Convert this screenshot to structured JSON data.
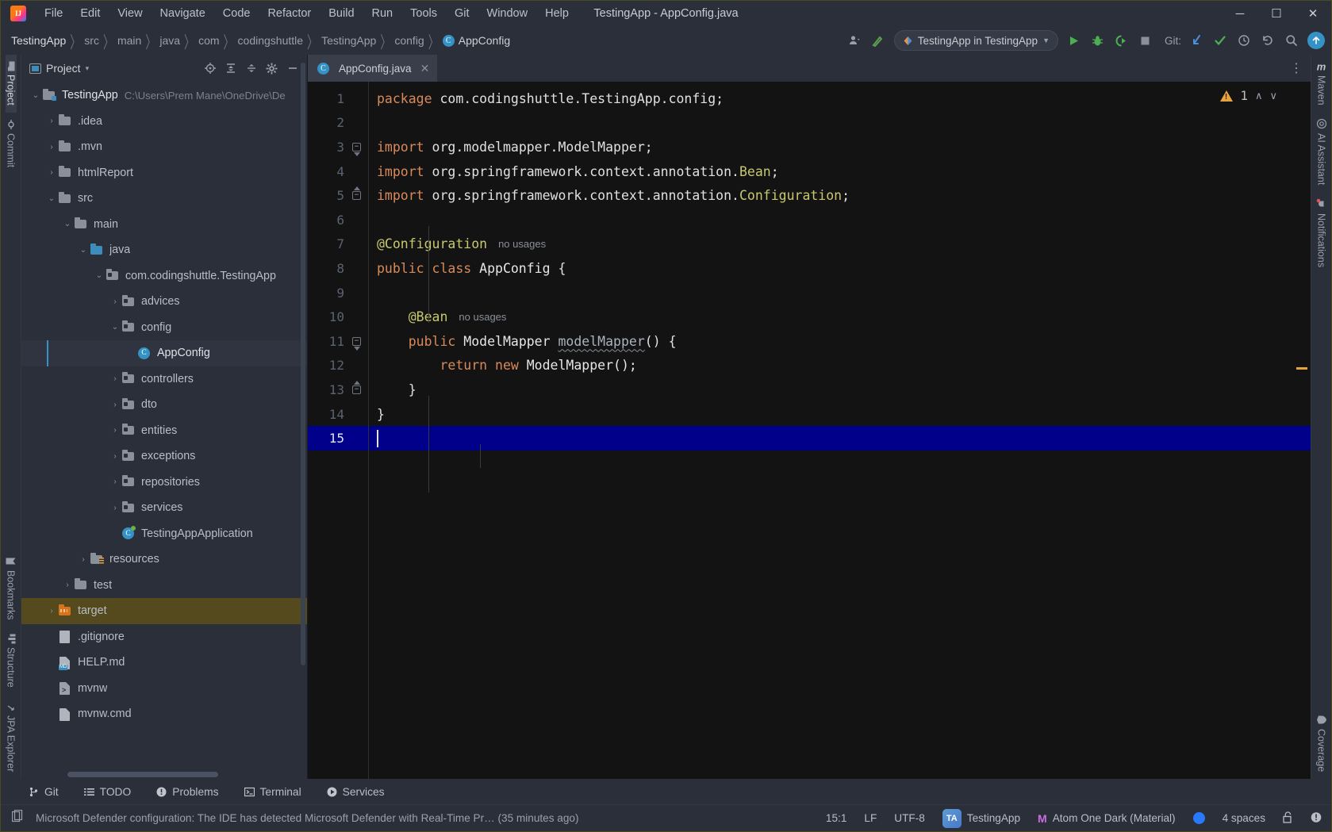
{
  "window": {
    "title": "TestingApp - AppConfig.java",
    "minimize": "─",
    "maximize": "☐",
    "close": "✕"
  },
  "menu": {
    "items": [
      "File",
      "Edit",
      "View",
      "Navigate",
      "Code",
      "Refactor",
      "Build",
      "Run",
      "Tools",
      "Git",
      "Window",
      "Help"
    ]
  },
  "navbar": {
    "breadcrumb": [
      "TestingApp",
      "src",
      "main",
      "java",
      "com",
      "codingshuttle",
      "TestingApp",
      "config",
      "AppConfig"
    ],
    "separator": "〉",
    "class_badge": "C",
    "run_config": "TestingApp in TestingApp",
    "run_config_caret": "▼",
    "git_label": "Git:",
    "icons": {
      "profile": "👤",
      "profile_caret": "▾",
      "build": "↖",
      "run": "▶",
      "debug": "🐞",
      "coverage": "◑",
      "stop": "■",
      "git_update": "↙",
      "git_commit": "✓",
      "history": "◴",
      "rollback": "↺",
      "search": "🔍",
      "update": "↑"
    }
  },
  "left_strip": {
    "top": [
      {
        "label": "Project",
        "icon": "project-icon",
        "active": true
      },
      {
        "label": "Commit",
        "icon": "commit-icon",
        "active": false
      }
    ],
    "bottom": [
      {
        "label": "Bookmarks",
        "icon": "bookmark-icon"
      },
      {
        "label": "Structure",
        "icon": "structure-icon"
      },
      {
        "label": "JPA Explorer",
        "icon": "jpa-icon"
      }
    ]
  },
  "right_strip": {
    "top": [
      {
        "label": "Maven",
        "icon": "maven-icon"
      },
      {
        "label": "AI Assistant",
        "icon": "ai-icon"
      },
      {
        "label": "Notifications",
        "icon": "notifications-icon"
      }
    ],
    "bottom": [
      {
        "label": "Coverage",
        "icon": "coverage-icon"
      }
    ]
  },
  "project_panel": {
    "title": "Project",
    "caret": "▾",
    "actions": [
      "locate-icon",
      "expand-all-icon",
      "collapse-all-icon",
      "settings-icon",
      "hide-icon"
    ],
    "tree": [
      {
        "label": "TestingApp",
        "path": "C:\\Users\\Prem Mane\\OneDrive\\De",
        "indent": 0,
        "arrow": "down",
        "icon": "module-folder",
        "state": "root"
      },
      {
        "label": ".idea",
        "indent": 1,
        "arrow": "right",
        "icon": "folder"
      },
      {
        "label": ".mvn",
        "indent": 1,
        "arrow": "right",
        "icon": "folder"
      },
      {
        "label": "htmlReport",
        "indent": 1,
        "arrow": "right",
        "icon": "folder"
      },
      {
        "label": "src",
        "indent": 1,
        "arrow": "down",
        "icon": "folder"
      },
      {
        "label": "main",
        "indent": 2,
        "arrow": "down",
        "icon": "folder"
      },
      {
        "label": "java",
        "indent": 3,
        "arrow": "down",
        "icon": "folder-blue"
      },
      {
        "label": "com.codingshuttle.TestingApp",
        "indent": 4,
        "arrow": "down",
        "icon": "package"
      },
      {
        "label": "advices",
        "indent": 5,
        "arrow": "right",
        "icon": "package"
      },
      {
        "label": "config",
        "indent": 5,
        "arrow": "down",
        "icon": "package"
      },
      {
        "label": "AppConfig",
        "indent": 6,
        "arrow": "none",
        "icon": "class",
        "selected": true
      },
      {
        "label": "controllers",
        "indent": 5,
        "arrow": "right",
        "icon": "package"
      },
      {
        "label": "dto",
        "indent": 5,
        "arrow": "right",
        "icon": "package"
      },
      {
        "label": "entities",
        "indent": 5,
        "arrow": "right",
        "icon": "package"
      },
      {
        "label": "exceptions",
        "indent": 5,
        "arrow": "right",
        "icon": "package"
      },
      {
        "label": "repositories",
        "indent": 5,
        "arrow": "right",
        "icon": "package"
      },
      {
        "label": "services",
        "indent": 5,
        "arrow": "right",
        "icon": "package"
      },
      {
        "label": "TestingAppApplication",
        "indent": 5,
        "arrow": "none",
        "icon": "spring-class"
      },
      {
        "label": "resources",
        "indent": 3,
        "arrow": "right",
        "icon": "folder-resources"
      },
      {
        "label": "test",
        "indent": 2,
        "arrow": "right",
        "icon": "folder"
      },
      {
        "label": "target",
        "indent": 1,
        "arrow": "right",
        "icon": "folder-orange",
        "highlight": true
      },
      {
        "label": ".gitignore",
        "indent": 1,
        "arrow": "none",
        "icon": "file-gitignore"
      },
      {
        "label": "HELP.md",
        "indent": 1,
        "arrow": "none",
        "icon": "file-md"
      },
      {
        "label": "mvnw",
        "indent": 1,
        "arrow": "none",
        "icon": "file-script"
      },
      {
        "label": "mvnw.cmd",
        "indent": 1,
        "arrow": "none",
        "icon": "file-cmd"
      }
    ]
  },
  "editor": {
    "tab": {
      "label": "AppConfig.java",
      "badge": "C",
      "close": "✕"
    },
    "more_icon": "⋮",
    "inspection_badge": {
      "count": "1",
      "icon": "warning-icon",
      "prev": "∧",
      "next": "∨"
    },
    "lines": [
      {
        "n": "1",
        "tokens": [
          {
            "t": "package ",
            "c": "kw"
          },
          {
            "t": "com.codingshuttle.TestingApp.config;",
            "c": "plain"
          }
        ]
      },
      {
        "n": "2",
        "tokens": []
      },
      {
        "n": "3",
        "fold": "start",
        "tokens": [
          {
            "t": "import ",
            "c": "kw"
          },
          {
            "t": "org.modelmapper.ModelMapper;",
            "c": "plain"
          }
        ]
      },
      {
        "n": "4",
        "tokens": [
          {
            "t": "import ",
            "c": "kw"
          },
          {
            "t": "org.springframework.context.annotation.",
            "c": "plain"
          },
          {
            "t": "Bean",
            "c": "anno"
          },
          {
            "t": ";",
            "c": "plain"
          }
        ]
      },
      {
        "n": "5",
        "fold": "end",
        "tokens": [
          {
            "t": "import ",
            "c": "kw"
          },
          {
            "t": "org.springframework.context.annotation.",
            "c": "plain"
          },
          {
            "t": "Configuration",
            "c": "anno"
          },
          {
            "t": ";",
            "c": "plain"
          }
        ]
      },
      {
        "n": "6",
        "tokens": []
      },
      {
        "n": "7",
        "tokens": [
          {
            "t": "@Configuration",
            "c": "anno"
          }
        ],
        "usages": "no usages"
      },
      {
        "n": "8",
        "tokens": [
          {
            "t": "public class ",
            "c": "kw"
          },
          {
            "t": "AppConfig",
            "c": "type"
          },
          {
            "t": " {",
            "c": "plain"
          }
        ]
      },
      {
        "n": "9",
        "tokens": []
      },
      {
        "n": "10",
        "tokens": [
          {
            "t": "    @Bean",
            "c": "anno"
          }
        ],
        "usages": "no usages"
      },
      {
        "n": "11",
        "fold": "start",
        "tokens": [
          {
            "t": "    public ",
            "c": "kw"
          },
          {
            "t": "ModelMapper ",
            "c": "type"
          },
          {
            "t": "modelMapper",
            "c": "squiggle"
          },
          {
            "t": "() {",
            "c": "plain"
          }
        ]
      },
      {
        "n": "12",
        "tokens": [
          {
            "t": "        return new ",
            "c": "kw"
          },
          {
            "t": "ModelMapper();",
            "c": "type"
          }
        ]
      },
      {
        "n": "13",
        "fold": "end",
        "tokens": [
          {
            "t": "    }",
            "c": "plain"
          }
        ]
      },
      {
        "n": "14",
        "tokens": [
          {
            "t": "}",
            "c": "plain"
          }
        ]
      },
      {
        "n": "15",
        "tokens": [],
        "current": true,
        "caret": true
      }
    ]
  },
  "bottom_bar": {
    "items": [
      {
        "label": "Git",
        "icon": "git-branch-icon"
      },
      {
        "label": "TODO",
        "icon": "todo-list-icon"
      },
      {
        "label": "Problems",
        "icon": "problems-icon"
      },
      {
        "label": "Terminal",
        "icon": "terminal-icon"
      },
      {
        "label": "Services",
        "icon": "services-icon"
      }
    ]
  },
  "status_bar": {
    "message": "Microsoft Defender configuration: The IDE has detected Microsoft Defender with Real-Time Pr… (35 minutes ago)",
    "message_icon": "copy-icon",
    "caret_position": "15:1",
    "line_separator": "LF",
    "encoding": "UTF-8",
    "branch_badge": "TA",
    "branch": "TestingApp",
    "theme_icon": "M",
    "theme": "Atom One Dark (Material)",
    "indicator_color": "#2979ff",
    "indent": "4 spaces",
    "lock_icon": "🔓",
    "notify_icon": "❗"
  },
  "colors": {
    "accent": "#3592c4",
    "warning": "#e8a33d",
    "keyword": "#d98a5a",
    "annotation": "#c8c86e",
    "current_line": "#00008b",
    "target_highlight": "#554a1e"
  }
}
